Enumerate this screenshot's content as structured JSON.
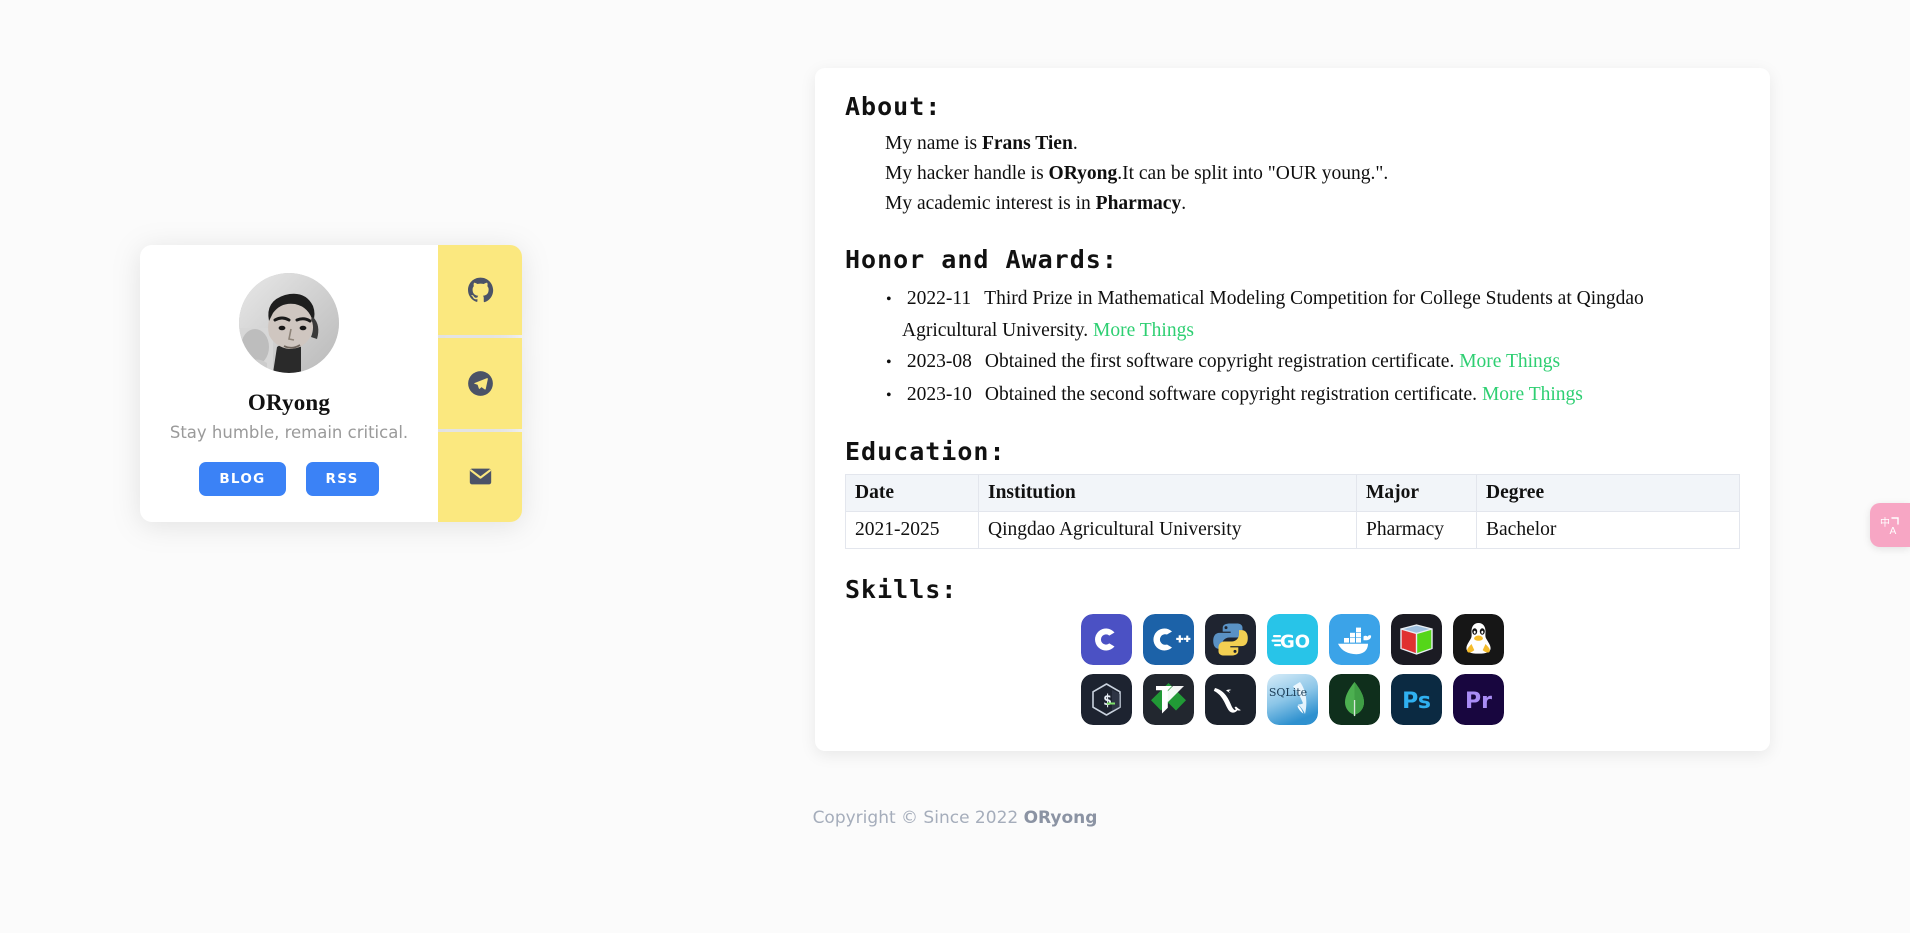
{
  "profile": {
    "name": "ORyong",
    "tagline": "Stay humble, remain critical.",
    "avatar_icon": "portrait-photo",
    "buttons": [
      {
        "label": "BLOG",
        "name": "blog-button"
      },
      {
        "label": "RSS",
        "name": "rss-button"
      }
    ],
    "social": [
      {
        "icon": "github-icon",
        "name": "social-link-github"
      },
      {
        "icon": "telegram-icon",
        "name": "social-link-telegram"
      },
      {
        "icon": "email-icon",
        "name": "social-link-email"
      }
    ],
    "accent_yellow": "#fbe87f",
    "accent_blue": "#3b82f6",
    "icon_color": "#4b5367"
  },
  "about": {
    "heading": "About:",
    "line1_pre": "My name is ",
    "line1_bold": "Frans Tien",
    "line1_post": ".",
    "line2_pre": "My hacker handle is ",
    "line2_bold": "ORyong",
    "line2_post": ".It can be split into \"OUR young.\".",
    "line3_pre": "My academic interest is in ",
    "line3_bold": "Pharmacy",
    "line3_post": "."
  },
  "honors": {
    "heading": "Honor and Awards:",
    "link_color": "#2ecf72",
    "items": [
      {
        "date": "2022-11",
        "text": "Third Prize in Mathematical Modeling Competition for College Students at Qingdao Agricultural University.",
        "link": "More Things"
      },
      {
        "date": "2023-08",
        "text": "Obtained the first software copyright registration certificate.",
        "link": "More Things"
      },
      {
        "date": "2023-10",
        "text": "Obtained the second software copyright registration certificate.",
        "link": "More Things"
      }
    ]
  },
  "education": {
    "heading": "Education:",
    "columns": [
      "Date",
      "Institution",
      "Major",
      "Degree"
    ],
    "rows": [
      {
        "date": "2021-2025",
        "institution": "Qingdao Agricultural University",
        "major": "Pharmacy",
        "degree": "Bachelor"
      }
    ]
  },
  "skills": {
    "heading": "Skills:",
    "row1": [
      {
        "name": "skill-c-icon",
        "label": "C"
      },
      {
        "name": "skill-cpp-icon",
        "label": "C++"
      },
      {
        "name": "skill-python-icon",
        "label": "Python"
      },
      {
        "name": "skill-go-icon",
        "label": "Go"
      },
      {
        "name": "skill-docker-icon",
        "label": "Docker"
      },
      {
        "name": "skill-virtualbox-icon",
        "label": "VirtualBox"
      },
      {
        "name": "skill-linux-icon",
        "label": "Linux"
      }
    ],
    "row2": [
      {
        "name": "skill-bash-icon",
        "label": "Bash"
      },
      {
        "name": "skill-vim-icon",
        "label": "Vim"
      },
      {
        "name": "skill-mysql-icon",
        "label": "MySQL"
      },
      {
        "name": "skill-sqlite-icon",
        "label": "SQLite"
      },
      {
        "name": "skill-mongodb-icon",
        "label": "MongoDB"
      },
      {
        "name": "skill-photoshop-icon",
        "label": "Ps"
      },
      {
        "name": "skill-premiere-icon",
        "label": "Pr"
      }
    ]
  },
  "footer": {
    "text": "Copyright © Since 2022 ",
    "owner": "ORyong"
  },
  "translate_widget": {
    "icon": "translate-icon",
    "label_cjk": "中",
    "label_latin": "A",
    "color": "#f7a6c4"
  }
}
